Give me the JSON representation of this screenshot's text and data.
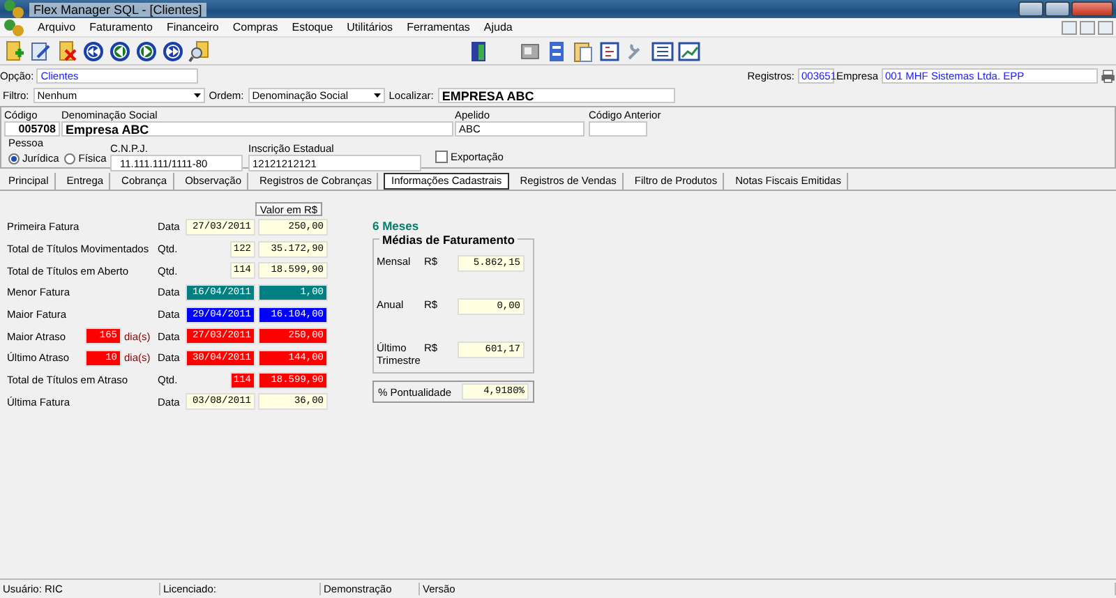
{
  "window": {
    "title": "Flex Manager SQL - [Clientes]"
  },
  "menu": [
    "Arquivo",
    "Faturamento",
    "Financeiro",
    "Compras",
    "Estoque",
    "Utilitários",
    "Ferramentas",
    "Ajuda"
  ],
  "option": {
    "label": "Opção:",
    "value": "Clientes"
  },
  "registros": {
    "label": "Registros:",
    "value": "003651"
  },
  "empresa": {
    "label": "Empresa",
    "value": "001 MHF Sistemas Ltda. EPP"
  },
  "filter": {
    "label": "Filtro:",
    "value": "Nenhum"
  },
  "order": {
    "label": "Ordem:",
    "value": "Denominação Social"
  },
  "search": {
    "label": "Localizar:",
    "value": "EMPRESA ABC"
  },
  "record": {
    "codigo": {
      "label": "Código",
      "value": "005708"
    },
    "denominacao": {
      "label": "Denominação Social",
      "value": "Empresa ABC"
    },
    "apelido": {
      "label": "Apelido",
      "value": "ABC"
    },
    "codigo_anterior": {
      "label": "Código Anterior"
    },
    "cnpj": {
      "label": "C.N.P.J.",
      "value": "11.111.111/1111-80"
    },
    "inscricao": {
      "label": "Inscrição Estadual",
      "value": "12121212121"
    }
  },
  "person": {
    "label": "Pessoa",
    "options": [
      {
        "label": "Jurídica",
        "selected": true
      },
      {
        "label": "Física",
        "selected": false
      }
    ]
  },
  "export": {
    "label": "Exportação",
    "checked": false
  },
  "tabs": [
    {
      "label": "Principal",
      "selected": false
    },
    {
      "label": "Entrega",
      "selected": false
    },
    {
      "label": "Cobrança",
      "selected": false
    },
    {
      "label": "Observação",
      "selected": false
    },
    {
      "label": "Registros de Cobranças",
      "selected": false
    },
    {
      "label": "Informações Cadastrais",
      "selected": true
    },
    {
      "label": "Registros de Vendas",
      "selected": false
    },
    {
      "label": "Filtro de Produtos",
      "selected": false
    },
    {
      "label": "Notas Fiscais Emitidas",
      "selected": false
    }
  ],
  "stats": {
    "value_header": "Valor em R$",
    "rows": [
      {
        "label": "Primeira Fatura",
        "unit": "Data",
        "kind": "date",
        "key": "27/03/2011",
        "value": "250,00",
        "color": "#ffffe1"
      },
      {
        "label": "Total de Títulos Movimentados",
        "unit": "Qtd.",
        "kind": "qty",
        "key": "122",
        "value": "35.172,90",
        "color": "#ffffe1"
      },
      {
        "label": "Total de Títulos em Aberto",
        "unit": "Qtd.",
        "kind": "qty",
        "key": "114",
        "value": "18.599,90",
        "color": "#ffffe1"
      },
      {
        "label": "Menor Fatura",
        "unit": "Data",
        "kind": "date",
        "key": "16/04/2011",
        "value": "1,00",
        "color": "#008080"
      },
      {
        "label": "Maior Fatura",
        "unit": "Data",
        "kind": "date",
        "key": "29/04/2011",
        "value": "16.104,00",
        "color": "#0000ff"
      },
      {
        "label": "Maior Atraso",
        "unit": "Data",
        "kind": "date",
        "days": {
          "value": "165",
          "unit": "dia(s)"
        },
        "key": "27/03/2011",
        "value": "250,00",
        "color": "#ff0000"
      },
      {
        "label": "Último Atraso",
        "unit": "Data",
        "kind": "date",
        "days": {
          "value": "10",
          "unit": "dia(s)"
        },
        "key": "30/04/2011",
        "value": "144,00",
        "color": "#ff0000"
      },
      {
        "label": "Total de Títulos em Atraso",
        "unit": "Qtd.",
        "kind": "qty",
        "key": "114",
        "value": "18.599,90",
        "color": "#ff0000"
      },
      {
        "label": "Última Fatura",
        "unit": "Data",
        "kind": "date",
        "key": "03/08/2011",
        "value": "36,00",
        "color": "#ffffe1"
      }
    ]
  },
  "period": "6 Meses",
  "averages": {
    "title": "Médias de Faturamento",
    "rows": [
      {
        "label": "Mensal",
        "currency": "R$",
        "value": "5.862,15"
      },
      {
        "label": "Anual",
        "currency": "R$",
        "value": "0,00"
      },
      {
        "label": "Último Trimestre",
        "currency": "R$",
        "value": "601,17"
      }
    ]
  },
  "punctuality": {
    "label": "% Pontualidade",
    "value": "4,9180%"
  },
  "status_bar": [
    "Usuário: RIC",
    "Licenciado:",
    "Demonstração",
    "Versão"
  ]
}
